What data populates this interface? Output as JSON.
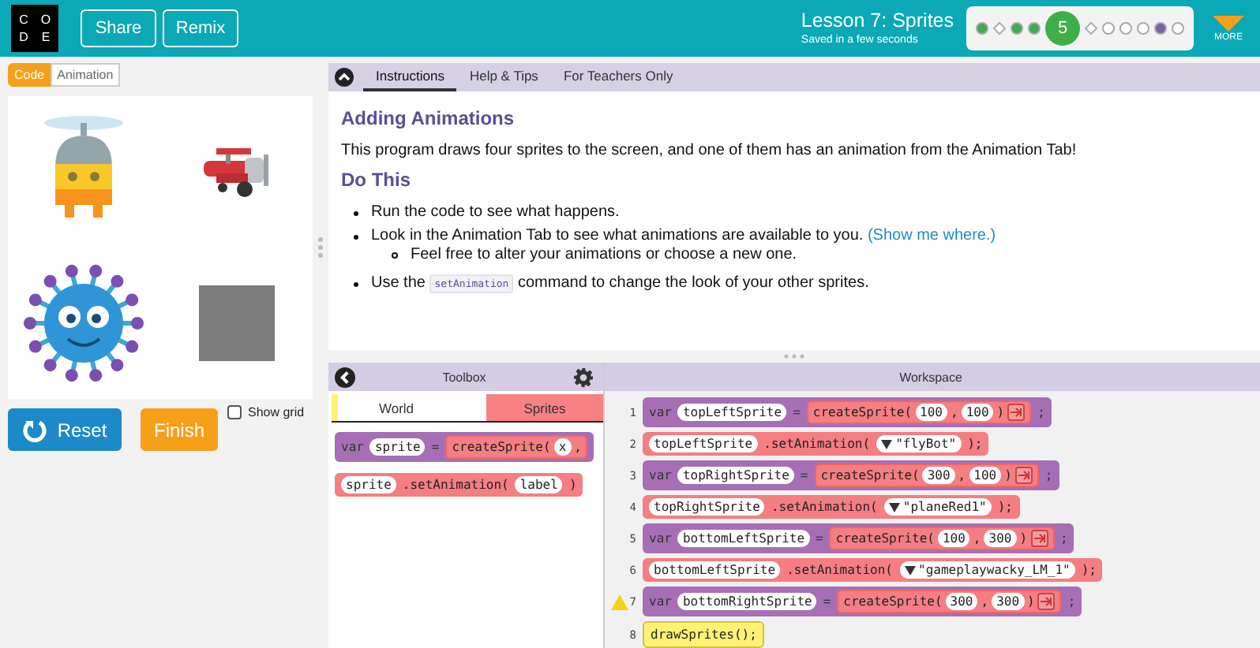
{
  "header": {
    "logo": [
      "C",
      "O",
      "D",
      "E"
    ],
    "buttons": [
      "Share",
      "Remix"
    ],
    "lesson_title": "Lesson 7: Sprites",
    "save_status": "Saved in a few seconds",
    "more_label": "MORE",
    "progress": [
      {
        "kind": "dot",
        "color": "#3fae49"
      },
      {
        "kind": "diamond",
        "color": "#ffffff"
      },
      {
        "kind": "dot",
        "color": "#3fae49"
      },
      {
        "kind": "dot",
        "color": "#3fae49"
      },
      {
        "kind": "current",
        "text": "5",
        "color": "#3fae49"
      },
      {
        "kind": "diamond",
        "color": "#ffffff"
      },
      {
        "kind": "dot",
        "color": "#ffffff"
      },
      {
        "kind": "dot",
        "color": "#ffffff"
      },
      {
        "kind": "dot",
        "color": "#ffffff"
      },
      {
        "kind": "dot",
        "color": "#7665a0"
      },
      {
        "kind": "dot",
        "color": "#ffffff"
      }
    ]
  },
  "left_tabs": [
    {
      "label": "Code",
      "selected": true
    },
    {
      "label": "Animation",
      "selected": false
    }
  ],
  "stage": {
    "sprites": [
      {
        "kind": "flybot"
      },
      {
        "kind": "plane"
      },
      {
        "kind": "virus"
      },
      {
        "kind": "square"
      }
    ]
  },
  "controls": {
    "reset": "Reset",
    "finish": "Finish",
    "show_grid": {
      "label": "Show grid",
      "checked": false
    }
  },
  "instruction_tabs": [
    {
      "label": "Instructions",
      "selected": true
    },
    {
      "label": "Help & Tips",
      "selected": false
    },
    {
      "label": "For Teachers Only",
      "selected": false
    }
  ],
  "instructions": {
    "title": "Adding Animations",
    "intro": "This program draws four sprites to the screen, and one of them has an animation from the Animation Tab!",
    "subtitle": "Do This",
    "items": [
      {
        "parts": [
          {
            "kind": "text",
            "text": "Run the code to see what happens."
          }
        ]
      },
      {
        "parts": [
          {
            "kind": "text",
            "text": "Look in the Animation Tab to see what animations are available to you. "
          },
          {
            "kind": "link",
            "text": "(Show me where.)"
          }
        ],
        "children": [
          {
            "parts": [
              {
                "kind": "text",
                "text": "Feel free to alter your animations or choose a new one."
              }
            ]
          }
        ]
      },
      {
        "parts": [
          {
            "kind": "text",
            "text": "Use the "
          },
          {
            "kind": "code",
            "text": "setAnimation"
          },
          {
            "kind": "text",
            "text": " command to change the look of your other sprites."
          }
        ]
      }
    ]
  },
  "toolbox": {
    "title": "Toolbox",
    "categories": [
      {
        "label": "World",
        "color": "#fff176",
        "selected": false
      },
      {
        "label": "Sprites",
        "color": "#f78183",
        "selected": true
      }
    ],
    "blocks": [
      {
        "kind": "var",
        "tokens": [
          {
            "kind": "text",
            "text": "var"
          },
          {
            "kind": "field",
            "text": "sprite"
          },
          {
            "kind": "text",
            "text": "="
          },
          {
            "kind": "block",
            "tokens": [
              {
                "kind": "text",
                "text": "createSprite("
              },
              {
                "kind": "field",
                "text": "x"
              },
              {
                "kind": "text",
                "text": ","
              }
            ]
          }
        ]
      },
      {
        "kind": "call",
        "tokens": [
          {
            "kind": "field",
            "text": "sprite"
          },
          {
            "kind": "text",
            "text": ".setAnimation("
          },
          {
            "kind": "field",
            "text": "label"
          },
          {
            "kind": "text",
            "text": ")"
          }
        ]
      }
    ]
  },
  "workspace": {
    "title": "Workspace",
    "lines": [
      {
        "number": "1",
        "warning": false,
        "kind": "var",
        "tokens": [
          {
            "kind": "text",
            "text": "var"
          },
          {
            "kind": "field",
            "text": "topLeftSprite"
          },
          {
            "kind": "text",
            "text": "="
          },
          {
            "kind": "block",
            "tokens": [
              {
                "kind": "text",
                "text": "createSprite("
              },
              {
                "kind": "field",
                "text": "100"
              },
              {
                "kind": "text",
                "text": ","
              },
              {
                "kind": "field",
                "text": "100"
              },
              {
                "kind": "text",
                "text": ")"
              },
              {
                "kind": "mutator"
              }
            ]
          },
          {
            "kind": "text",
            "text": ";"
          }
        ]
      },
      {
        "number": "2",
        "warning": false,
        "kind": "call",
        "tokens": [
          {
            "kind": "field",
            "text": "topLeftSprite"
          },
          {
            "kind": "text",
            "text": ".setAnimation("
          },
          {
            "kind": "dropdown",
            "text": "\"flyBot\""
          },
          {
            "kind": "text",
            "text": ");"
          }
        ]
      },
      {
        "number": "3",
        "warning": false,
        "kind": "var",
        "tokens": [
          {
            "kind": "text",
            "text": "var"
          },
          {
            "kind": "field",
            "text": "topRightSprite"
          },
          {
            "kind": "text",
            "text": "="
          },
          {
            "kind": "block",
            "tokens": [
              {
                "kind": "text",
                "text": "createSprite("
              },
              {
                "kind": "field",
                "text": "300"
              },
              {
                "kind": "text",
                "text": ","
              },
              {
                "kind": "field",
                "text": "100"
              },
              {
                "kind": "text",
                "text": ")"
              },
              {
                "kind": "mutator"
              }
            ]
          },
          {
            "kind": "text",
            "text": ";"
          }
        ]
      },
      {
        "number": "4",
        "warning": false,
        "kind": "call",
        "tokens": [
          {
            "kind": "field",
            "text": "topRightSprite"
          },
          {
            "kind": "text",
            "text": ".setAnimation("
          },
          {
            "kind": "dropdown",
            "text": "\"planeRed1\""
          },
          {
            "kind": "text",
            "text": ");"
          }
        ]
      },
      {
        "number": "5",
        "warning": false,
        "kind": "var",
        "tokens": [
          {
            "kind": "text",
            "text": "var"
          },
          {
            "kind": "field",
            "text": "bottomLeftSprite"
          },
          {
            "kind": "text",
            "text": "="
          },
          {
            "kind": "block",
            "tokens": [
              {
                "kind": "text",
                "text": "createSprite("
              },
              {
                "kind": "field",
                "text": "100"
              },
              {
                "kind": "text",
                "text": ","
              },
              {
                "kind": "field",
                "text": "300"
              },
              {
                "kind": "text",
                "text": ")"
              },
              {
                "kind": "mutator"
              }
            ]
          },
          {
            "kind": "text",
            "text": ";"
          }
        ]
      },
      {
        "number": "6",
        "warning": false,
        "kind": "call",
        "tokens": [
          {
            "kind": "field",
            "text": "bottomLeftSprite"
          },
          {
            "kind": "text",
            "text": ".setAnimation("
          },
          {
            "kind": "dropdown",
            "text": "\"gameplaywacky_LM_1\""
          },
          {
            "kind": "text",
            "text": ");"
          }
        ]
      },
      {
        "number": "7",
        "warning": true,
        "kind": "var",
        "tokens": [
          {
            "kind": "text",
            "text": "var"
          },
          {
            "kind": "field",
            "text": "bottomRightSprite"
          },
          {
            "kind": "text",
            "text": "="
          },
          {
            "kind": "block",
            "tokens": [
              {
                "kind": "text",
                "text": "createSprite("
              },
              {
                "kind": "field",
                "text": "300"
              },
              {
                "kind": "text",
                "text": ","
              },
              {
                "kind": "field",
                "text": "300"
              },
              {
                "kind": "text",
                "text": ")"
              },
              {
                "kind": "mutator"
              }
            ]
          },
          {
            "kind": "text",
            "text": ";"
          }
        ]
      },
      {
        "number": "8",
        "warning": false,
        "kind": "statement",
        "tokens": [
          {
            "kind": "text",
            "text": "drawSprites();"
          }
        ]
      }
    ]
  }
}
